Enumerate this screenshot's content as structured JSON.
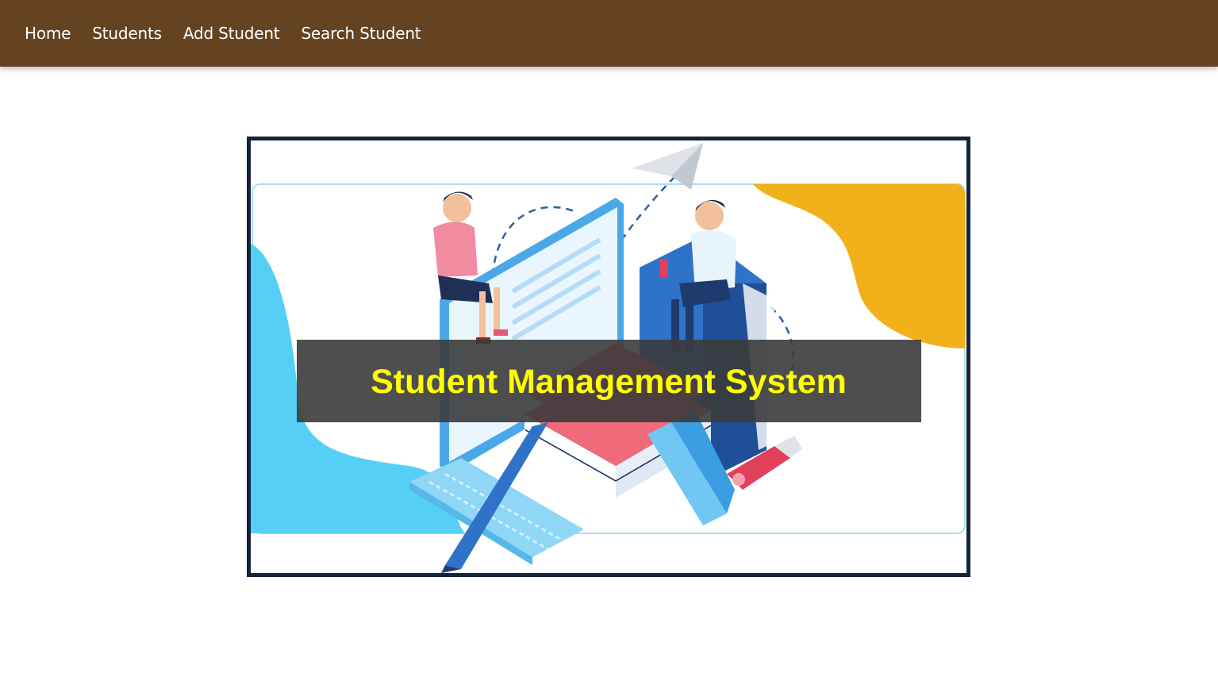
{
  "nav": {
    "items": [
      {
        "label": "Home"
      },
      {
        "label": "Students"
      },
      {
        "label": "Add Student"
      },
      {
        "label": "Search Student"
      }
    ],
    "background_color": "#654321",
    "text_color": "#ffffff"
  },
  "hero": {
    "banner_title": "Student Management System",
    "title_color": "#ffff00",
    "frame_color": "#15243d",
    "accent_colors": [
      "#4fcff5",
      "#f0b11b",
      "#f06a7a",
      "#2f73c9"
    ]
  }
}
